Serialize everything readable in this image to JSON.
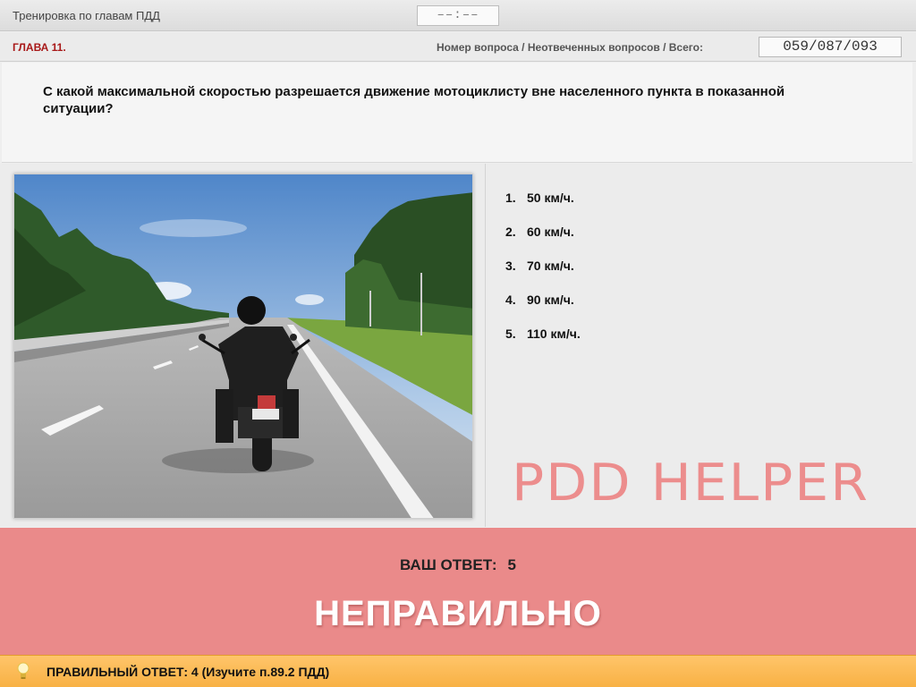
{
  "header": {
    "title": "Тренировка по главам ПДД",
    "timer": "––:––"
  },
  "chapter": {
    "label": "ГЛАВА 11.",
    "counter_label": "Номер вопроса / Неотвеченных вопросов / Всего:",
    "counter_value": "059/087/093"
  },
  "question": {
    "text": "С какой максимальной скоростью разрешается движение мотоциклисту вне населенного пункта в показанной ситуации?"
  },
  "answers": [
    {
      "num": "1.",
      "label": "50 км/ч."
    },
    {
      "num": "2.",
      "label": "60 км/ч."
    },
    {
      "num": "3.",
      "label": "70 км/ч."
    },
    {
      "num": "4.",
      "label": "90 км/ч."
    },
    {
      "num": "5.",
      "label": "110 км/ч."
    }
  ],
  "watermark": "PDD HELPER",
  "result": {
    "your_answer_label": "ВАШ ОТВЕТ:",
    "your_answer_value": "5",
    "verdict": "НЕПРАВИЛЬНО"
  },
  "correct": {
    "text": "ПРАВИЛЬНЫЙ ОТВЕТ:   4   (Изучите п.89.2 ПДД)",
    "icon": "lightbulb-icon"
  },
  "colors": {
    "chapter_red": "#a81818",
    "wrong_bg": "#ea8a8a",
    "correct_bg": "#f8b144",
    "watermark": "#ec8d8d"
  }
}
